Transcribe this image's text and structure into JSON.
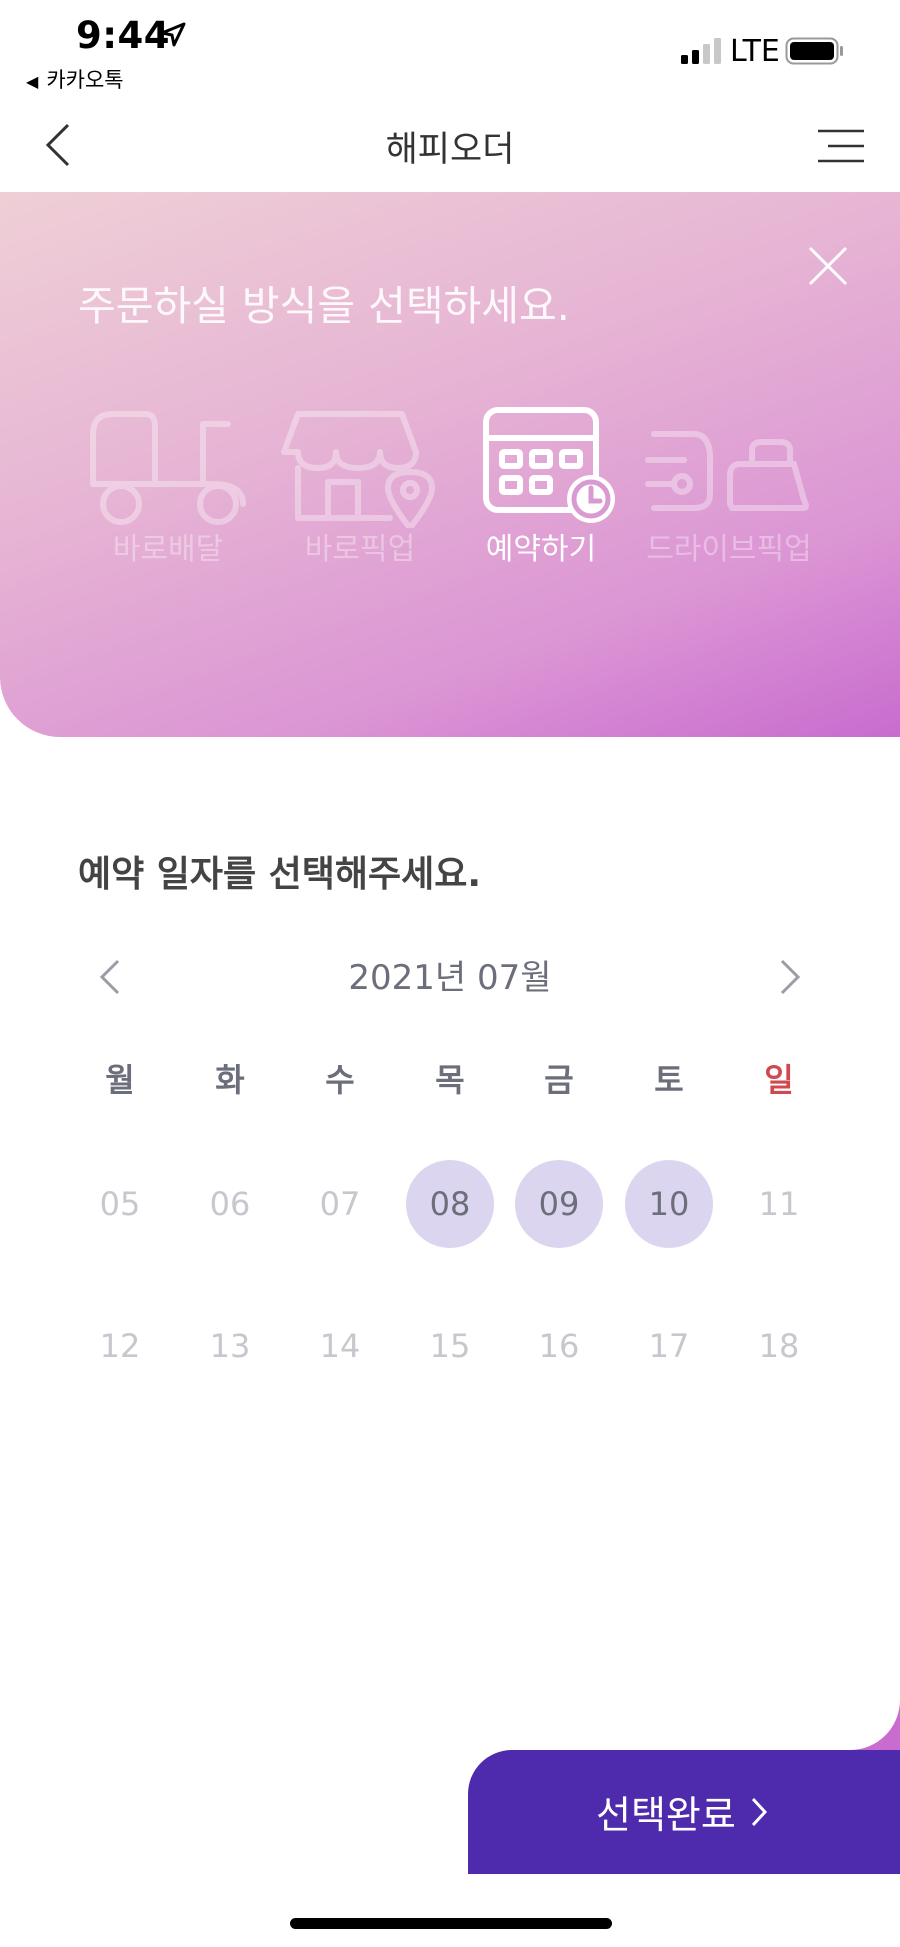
{
  "status_bar": {
    "time": "9:44",
    "back_app": "카카오톡",
    "network": "LTE"
  },
  "nav": {
    "title": "해피오더"
  },
  "hero": {
    "title": "주문하실 방식을 선택하세요.",
    "modes": [
      {
        "label": "바로배달",
        "icon": "scooter-icon",
        "active": false
      },
      {
        "label": "바로픽업",
        "icon": "store-pin-icon",
        "active": false
      },
      {
        "label": "예약하기",
        "icon": "calendar-clock-icon",
        "active": true
      },
      {
        "label": "드라이브픽업",
        "icon": "car-bag-icon",
        "active": false
      }
    ]
  },
  "reservation": {
    "title": "예약 일자를 선택해주세요.",
    "month": "2021년 07월",
    "weekdays": [
      "월",
      "화",
      "수",
      "목",
      "금",
      "토",
      "일"
    ],
    "weeks": [
      [
        "05",
        "06",
        "07",
        "08",
        "09",
        "10",
        "11"
      ],
      [
        "12",
        "13",
        "14",
        "15",
        "16",
        "17",
        "18"
      ]
    ],
    "available_days": [
      "08",
      "09",
      "10"
    ]
  },
  "confirm_button": {
    "label": "선택완료"
  },
  "colors": {
    "accent": "#4e2aad",
    "available_day_bg": "#dcd5ef",
    "sunday": "#d0494f",
    "gradient_start": "#efcfd6",
    "gradient_end": "#c86ccf"
  }
}
